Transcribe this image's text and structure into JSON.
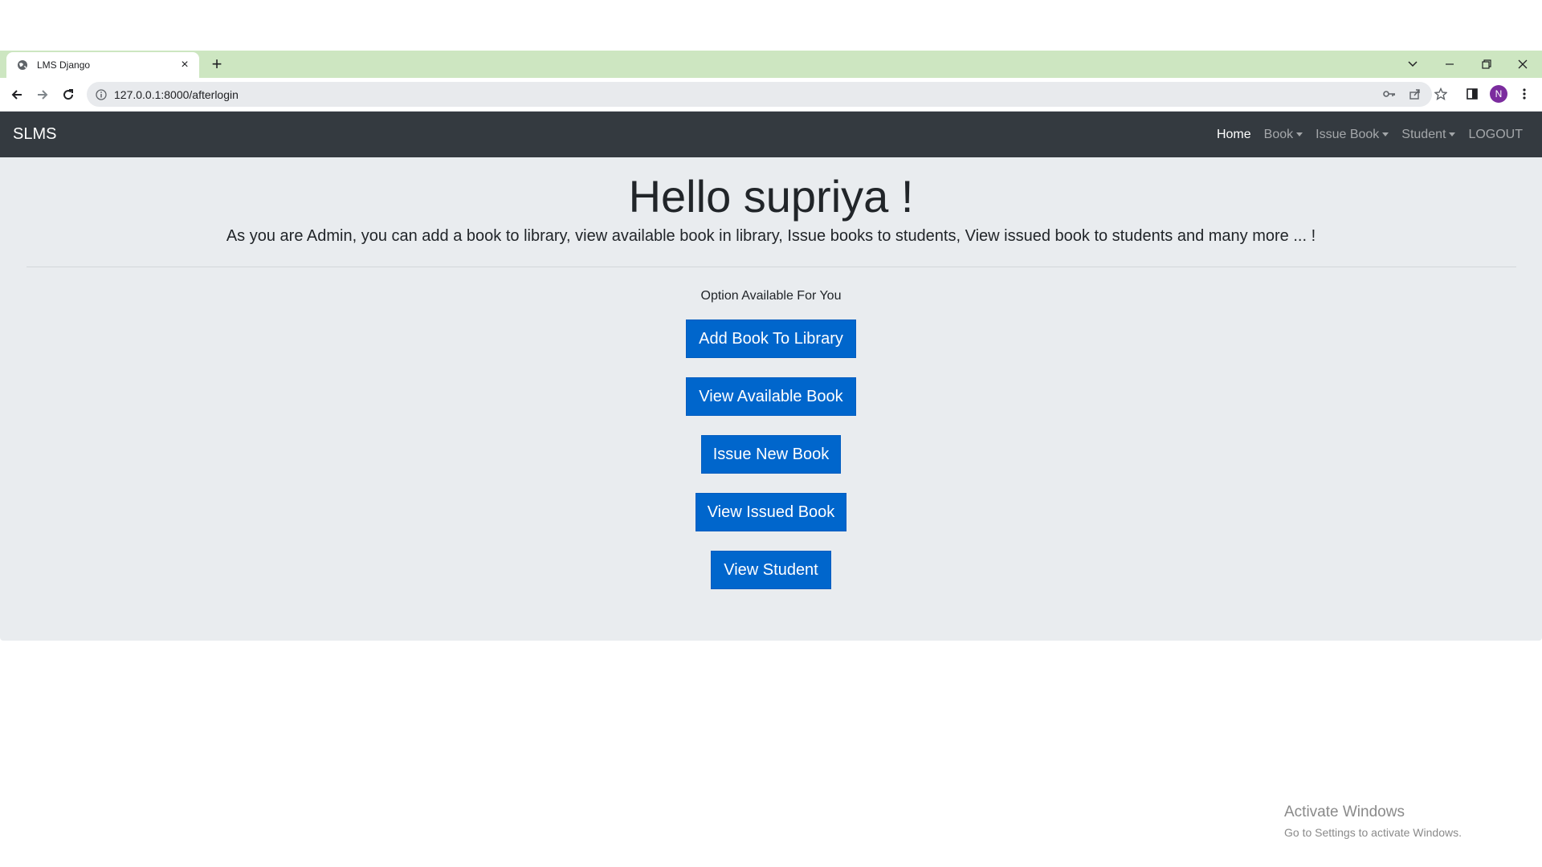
{
  "browser": {
    "tab_title": "LMS Django",
    "new_tab": "+",
    "url": "127.0.0.1:8000/afterlogin",
    "profile_initial": "N"
  },
  "navbar": {
    "brand": "SLMS",
    "links": [
      {
        "label": "Home"
      },
      {
        "label": "Book"
      },
      {
        "label": "Issue Book"
      },
      {
        "label": "Student"
      },
      {
        "label": "LOGOUT"
      }
    ]
  },
  "main": {
    "greeting": "Hello supriya !",
    "lead": "As you are Admin, you can add a book to library, view available book in library, Issue books to students, View issued book to students and many more ... !",
    "options_heading": "Option Available For You",
    "buttons": [
      {
        "label": "Add Book To Library"
      },
      {
        "label": "View Available Book"
      },
      {
        "label": "Issue New Book"
      },
      {
        "label": "View Issued Book"
      },
      {
        "label": "View Student"
      }
    ]
  },
  "watermark": {
    "line1": "Activate Windows",
    "line2": "Go to Settings to activate Windows."
  },
  "colors": {
    "tabstrip": "#cde6c1",
    "navbar": "#343a40",
    "jumbotron": "#e9ecef",
    "button": "#0066cc"
  }
}
